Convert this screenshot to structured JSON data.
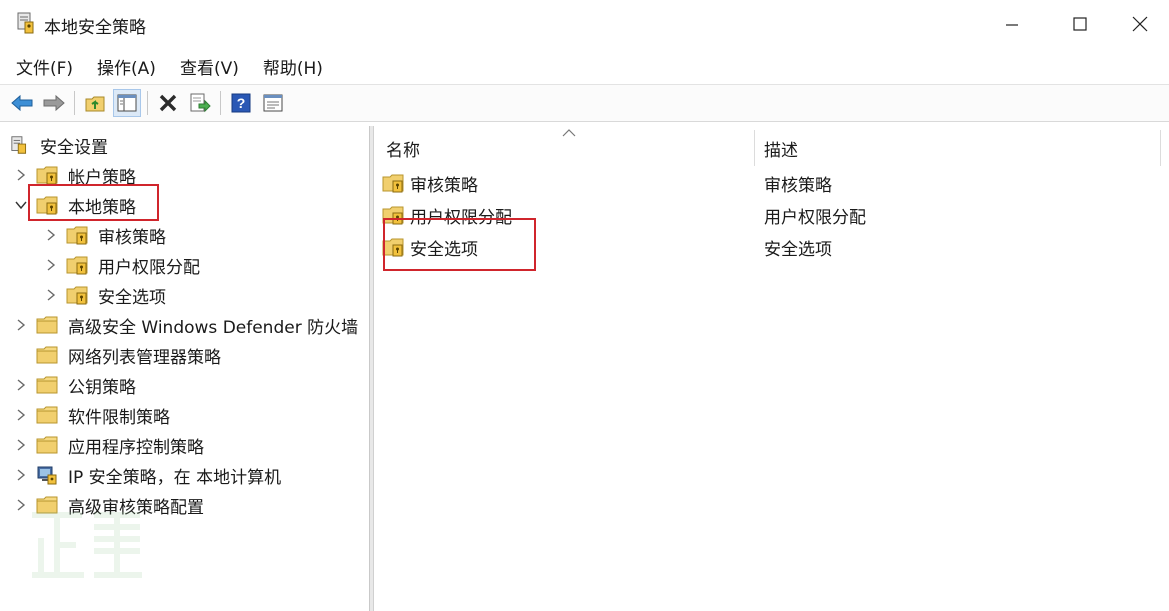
{
  "window": {
    "title": "本地安全策略",
    "controls": {
      "minimize": "—",
      "maximize": "☐",
      "close": "✕"
    }
  },
  "menu": {
    "items": [
      "文件(F)",
      "操作(A)",
      "查看(V)",
      "帮助(H)"
    ]
  },
  "toolbar": {
    "buttons": [
      "back-icon",
      "forward-icon",
      "up-folder-icon",
      "show-tree-icon",
      "delete-icon",
      "export-icon",
      "help-icon",
      "properties-icon"
    ]
  },
  "tree": {
    "root": "安全设置",
    "items": [
      {
        "label": "帐户策略",
        "expanded": false,
        "level": 1,
        "icon": "policy-folder"
      },
      {
        "label": "本地策略",
        "expanded": true,
        "level": 1,
        "icon": "policy-folder",
        "highlighted": true
      },
      {
        "label": "审核策略",
        "expanded": false,
        "level": 2,
        "icon": "policy-folder"
      },
      {
        "label": "用户权限分配",
        "expanded": false,
        "level": 2,
        "icon": "policy-folder"
      },
      {
        "label": "安全选项",
        "expanded": false,
        "level": 2,
        "icon": "policy-folder"
      },
      {
        "label": "高级安全 Windows Defender 防火墙",
        "expanded": false,
        "level": 1,
        "icon": "folder"
      },
      {
        "label": "网络列表管理器策略",
        "expanded": null,
        "level": 1,
        "icon": "folder"
      },
      {
        "label": "公钥策略",
        "expanded": false,
        "level": 1,
        "icon": "folder"
      },
      {
        "label": "软件限制策略",
        "expanded": false,
        "level": 1,
        "icon": "folder"
      },
      {
        "label": "应用程序控制策略",
        "expanded": false,
        "level": 1,
        "icon": "folder"
      },
      {
        "label": "IP 安全策略，在 本地计算机",
        "expanded": false,
        "level": 1,
        "icon": "ip-security"
      },
      {
        "label": "高级审核策略配置",
        "expanded": false,
        "level": 1,
        "icon": "folder"
      }
    ]
  },
  "list": {
    "columns": {
      "name": "名称",
      "description": "描述"
    },
    "rows": [
      {
        "name": "审核策略",
        "description": "审核策略"
      },
      {
        "name": "用户权限分配",
        "description": "用户权限分配"
      },
      {
        "name": "安全选项",
        "description": "安全选项",
        "highlighted": true
      }
    ]
  },
  "watermark": {
    "text": "正量"
  },
  "colors": {
    "highlight_border": "#d0252c",
    "folder_yellow": "#f1cf6e",
    "accent_blue": "#2a6fc9"
  }
}
